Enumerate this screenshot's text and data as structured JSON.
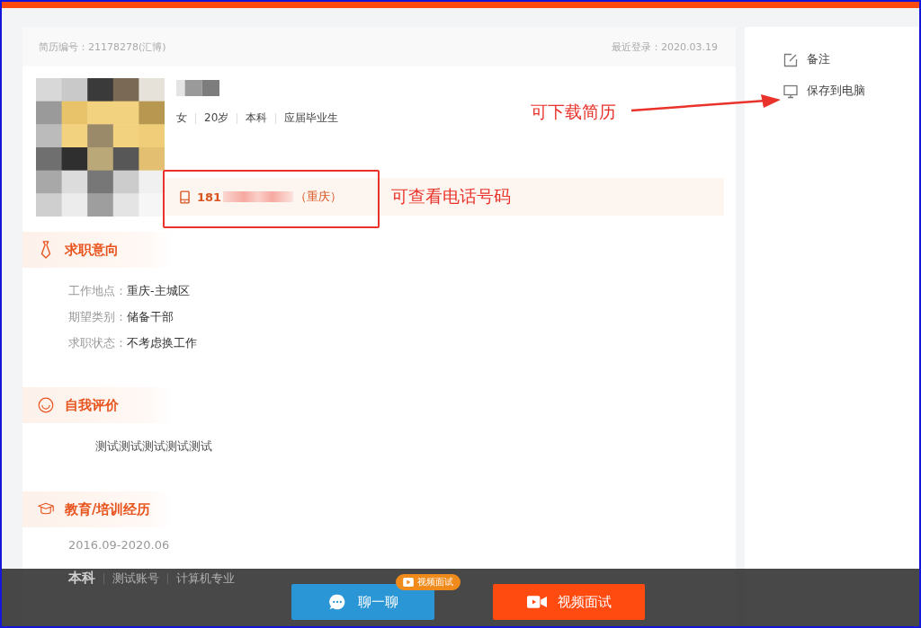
{
  "header": {
    "resume_id": "简历编号：21178278(汇博)",
    "last_login": "最近登录：2020.03.19"
  },
  "profile": {
    "details": [
      "女",
      "20岁",
      "本科",
      "应届毕业生"
    ],
    "phone": {
      "prefix": "181",
      "region": "（重庆）"
    }
  },
  "sections": [
    {
      "kind": "intention",
      "title": "求职意向",
      "fields": [
        {
          "label": "工作地点：",
          "value": "重庆-主城区"
        },
        {
          "label": "期望类别：",
          "value": "储备干部"
        },
        {
          "label": "求职状态：",
          "value": "不考虑换工作"
        }
      ]
    },
    {
      "kind": "self",
      "title": "自我评价",
      "text": "测试测试测试测试测试"
    },
    {
      "kind": "education",
      "title": "教育/培训经历",
      "entries": [
        {
          "period": "2016.09-2020.06",
          "degree": "本科",
          "school": "测试账号",
          "major": "计算机专业"
        }
      ]
    }
  ],
  "side_actions": [
    {
      "kind": "note",
      "label": "备注"
    },
    {
      "kind": "save",
      "label": "保存到电脑"
    }
  ],
  "annotations": [
    {
      "kind": "phone",
      "text": "可查看电话号码"
    },
    {
      "kind": "download",
      "text": "可下载简历"
    }
  ],
  "bottom_bar": {
    "chat_button": "聊一聊",
    "chat_badge": "视频面试",
    "video_button": "视频面试"
  }
}
